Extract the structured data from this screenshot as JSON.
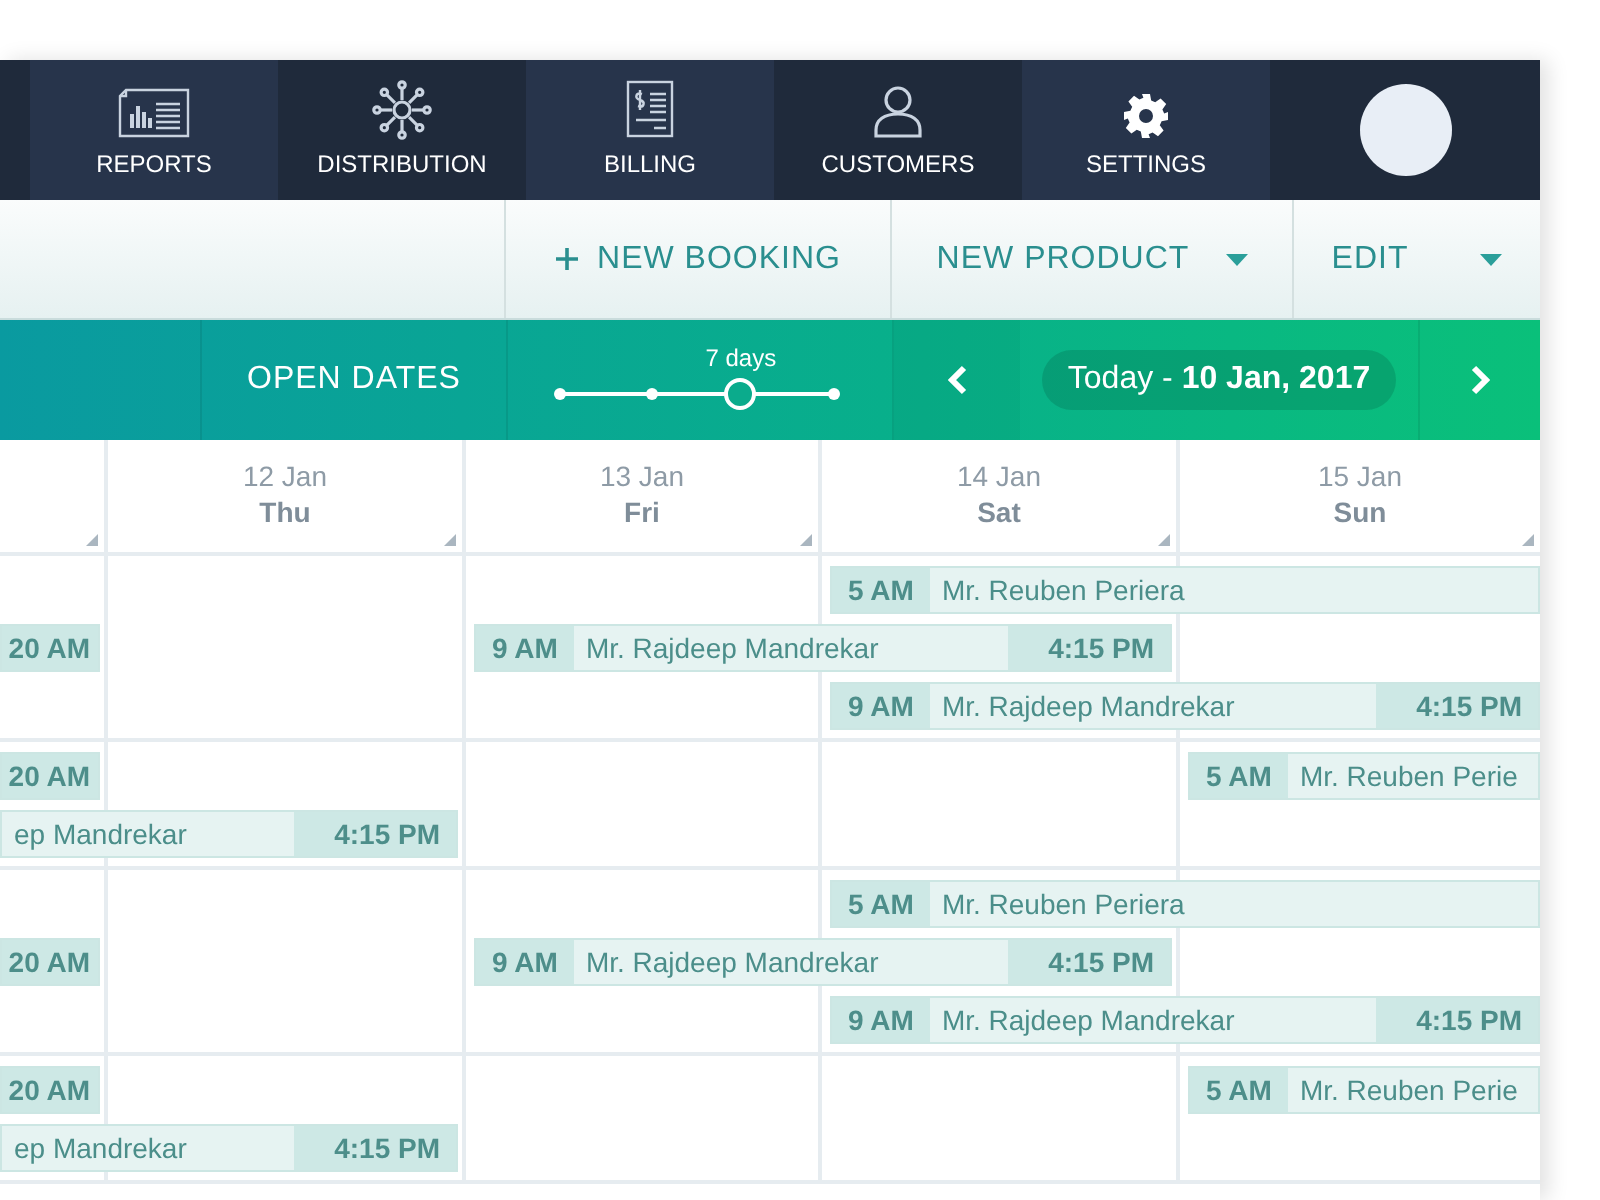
{
  "nav": {
    "items": [
      {
        "label": "REPORTS",
        "kind": "reports"
      },
      {
        "label": "DISTRIBUTION",
        "kind": "distribution"
      },
      {
        "label": "BILLING",
        "kind": "billing"
      },
      {
        "label": "CUSTOMERS",
        "kind": "customers"
      },
      {
        "label": "SETTINGS",
        "kind": "settings"
      }
    ]
  },
  "toolbar": {
    "buttons": [
      {
        "label": "NEW BOOKING",
        "kind": "add"
      },
      {
        "label": "NEW PRODUCT",
        "kind": "dropdown"
      },
      {
        "label": "EDIT",
        "kind": "dropdown"
      }
    ]
  },
  "date_bar": {
    "open_dates": "OPEN DATES",
    "range": {
      "label": "7 days",
      "level": 0.66
    },
    "date": "Today - **10 Jan, 2017**"
  },
  "calendar": {
    "columns": [
      {
        "date": "12 Jan",
        "day": "Thu"
      },
      {
        "date": "13 Jan",
        "day": "Fri"
      },
      {
        "date": "14 Jan",
        "day": "Sat"
      },
      {
        "date": "15 Jan",
        "day": "Sun"
      }
    ],
    "rows": [
      {
        "lanes": [
          [
            {
              "kind": "empty"
            },
            {
              "kind": "empty"
            },
            {
              "kind": "empty"
            },
            {
              "kind": "booking",
              "start": "5 AM",
              "name": "Mr. Reuben Periera",
              "continues_next_day": true
            }
          ],
          [
            {
              "kind": "booking",
              "end": "20 AM",
              "continues_next_day": false
            },
            {
              "kind": "empty"
            },
            {
              "kind": "booking",
              "start": "9 AM",
              "name": "Mr. Rajdeep Mandrekar",
              "end": "4:15 PM",
              "continues_next_day": true
            }
          ],
          [
            {
              "kind": "empty"
            },
            {
              "kind": "empty"
            },
            {
              "kind": "empty"
            },
            {
              "kind": "booking",
              "start": "9 AM",
              "name": "Mr. Rajdeep Mandrekar",
              "end": "4:15 PM",
              "continues_next_day": true
            }
          ]
        ]
      },
      {
        "lanes": [
          [
            {
              "kind": "booking",
              "end": "20 AM",
              "continues_next_day": false
            },
            {
              "kind": "empty"
            },
            {
              "kind": "empty"
            },
            {
              "kind": "empty"
            },
            {
              "kind": "booking",
              "start": "5 AM",
              "name": "Mr. Reuben Perie",
              "continues_next_day": false
            }
          ],
          [
            {
              "kind": "booking",
              "name": "ep Mandrekar",
              "end": "4:15 PM",
              "continues_next_day": true
            }
          ]
        ]
      },
      {
        "lanes": [
          [
            {
              "kind": "empty"
            },
            {
              "kind": "empty"
            },
            {
              "kind": "empty"
            },
            {
              "kind": "booking",
              "start": "5 AM",
              "name": "Mr. Reuben Periera",
              "continues_next_day": true
            }
          ],
          [
            {
              "kind": "booking",
              "end": "20 AM",
              "continues_next_day": false
            },
            {
              "kind": "empty"
            },
            {
              "kind": "booking",
              "start": "9 AM",
              "name": "Mr. Rajdeep Mandrekar",
              "end": "4:15 PM",
              "continues_next_day": true
            }
          ],
          [
            {
              "kind": "empty"
            },
            {
              "kind": "empty"
            },
            {
              "kind": "empty"
            },
            {
              "kind": "booking",
              "start": "9 AM",
              "name": "Mr. Rajdeep Mandrekar",
              "end": "4:15 PM",
              "continues_next_day": true
            }
          ]
        ]
      },
      {
        "lanes": [
          [
            {
              "kind": "booking",
              "end": "20 AM",
              "continues_next_day": false
            },
            {
              "kind": "empty"
            },
            {
              "kind": "empty"
            },
            {
              "kind": "empty"
            },
            {
              "kind": "booking",
              "start": "5 AM",
              "name": "Mr. Reuben Perie",
              "continues_next_day": false
            }
          ],
          [
            {
              "kind": "booking",
              "name": "ep Mandrekar",
              "end": "4:15 PM",
              "continues_next_day": true
            }
          ]
        ]
      }
    ]
  }
}
